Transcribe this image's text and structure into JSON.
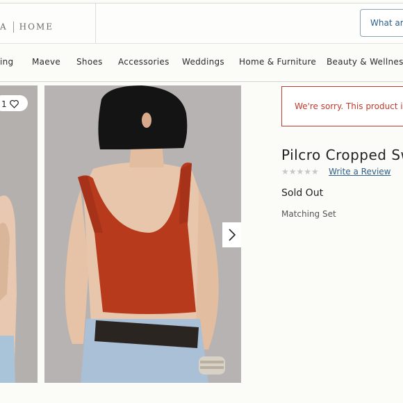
{
  "header": {
    "logo_left": "A",
    "logo_right": "HOME",
    "search_placeholder": "What are"
  },
  "nav": {
    "items": [
      {
        "label": "ing"
      },
      {
        "label": "Maeve"
      },
      {
        "label": "Shoes"
      },
      {
        "label": "Accessories"
      },
      {
        "label": "Weddings"
      },
      {
        "label": "Home & Furniture"
      },
      {
        "label": "Beauty & Wellness"
      }
    ]
  },
  "gallery": {
    "image_count_label": "1",
    "heart_icon": "heart-outline-icon",
    "next_icon": "chevron-right-icon"
  },
  "product": {
    "error_message": "We're sorry. This product is",
    "title": "Pilcro Cropped Sw",
    "stars": "★★★★★",
    "rating_value": 0,
    "review_link": "Write a Review",
    "availability": "Sold Out",
    "subtitle": "Matching Set"
  },
  "colors": {
    "error": "#c0392b",
    "link": "#2c5f8a",
    "sweater": "#b83a1d"
  }
}
